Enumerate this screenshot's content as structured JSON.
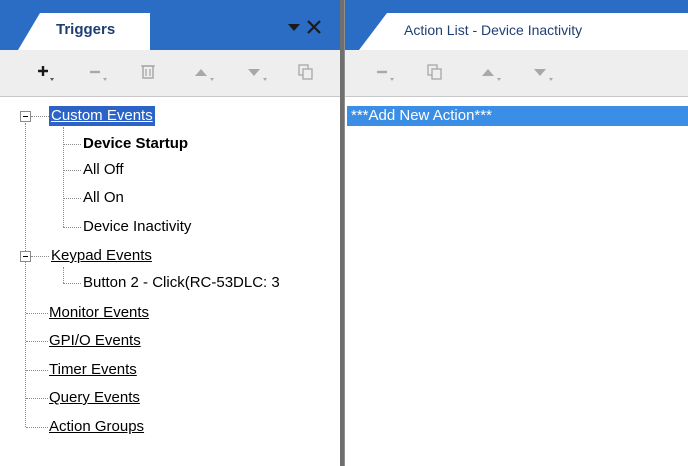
{
  "left_pane": {
    "tab_label": "Triggers",
    "toolbar": [
      "add-icon",
      "remove-icon",
      "delete-icon",
      "move-up-icon",
      "move-down-icon",
      "copy-icon"
    ]
  },
  "tree": {
    "custom_events": "Custom Events",
    "device_startup": "Device Startup",
    "all_off": "All Off",
    "all_on": "All On",
    "device_inactivity": "Device Inactivity",
    "keypad_events": "Keypad Events",
    "button2": "Button 2 - Click(RC-53DLC: 3",
    "monitor_events": "Monitor Events",
    "gpio_events": "GPI/O Events",
    "timer_events": "Timer Events",
    "query_events": "Query Events",
    "action_groups": "Action Groups"
  },
  "right_pane": {
    "tab_label": "Action List - Device Inactivity",
    "toolbar": [
      "remove-icon",
      "copy-icon",
      "move-up-icon",
      "move-down-icon"
    ],
    "add_action": "***Add New Action***"
  },
  "colors": {
    "tab_strip": "#2b6cc4",
    "selection": "#2b63c7",
    "action_row": "#3a8ee6"
  }
}
